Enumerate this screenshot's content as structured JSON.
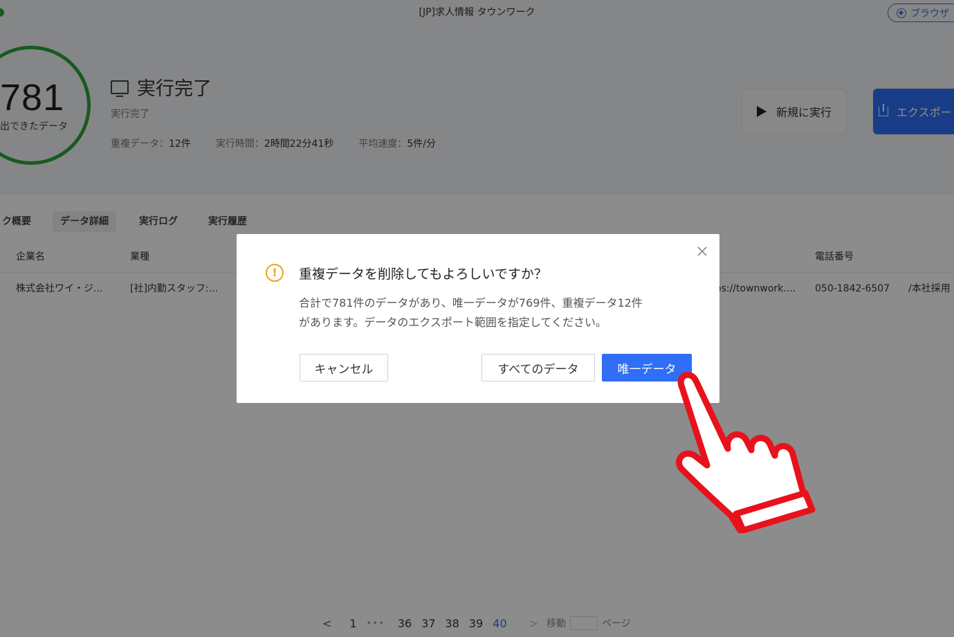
{
  "window": {
    "title": "[JP]求人情報 タウンワーク",
    "browser_button": "ブラウザ"
  },
  "summary": {
    "count": "781",
    "count_label": "出できたデータ",
    "status_title": "実行完了",
    "status_sub": "実行完了",
    "stats": [
      {
        "label": "重複データ：",
        "value": "12件"
      },
      {
        "label": "実行時間：",
        "value": "2時間22分41秒"
      },
      {
        "label": "平均速度：",
        "value": "5件/分"
      }
    ]
  },
  "actions": {
    "run_new": "新規に実行",
    "export": "エクスポート"
  },
  "tabs": [
    {
      "label": "ク概要"
    },
    {
      "label": "データ詳細"
    },
    {
      "label": "実行ログ"
    },
    {
      "label": "実行履歴"
    }
  ],
  "table": {
    "columns": [
      "企業名",
      "業種",
      "電話番号"
    ],
    "row": {
      "company": "株式会社ワイ・ジ...",
      "industry": "[社]内勤スタッフ:...",
      "url": "os://townwork....",
      "phone": "050-1842-6507",
      "extra": "/本社採用"
    }
  },
  "pagination": {
    "first": "1",
    "pages": [
      "36",
      "37",
      "38",
      "39",
      "40"
    ],
    "current": "40",
    "jump_label": "移動",
    "page_suffix": "ページ"
  },
  "dialog": {
    "title": "重複データを削除してもよろしいですか？",
    "message_line1": "合計で781件のデータがあり、唯一データが769件、重複データ12件",
    "message_line2": "があります。データのエクスポート範囲を指定してください。",
    "cancel": "キャンセル",
    "all_data": "すべてのデータ",
    "unique_data": "唯一データ"
  },
  "colors": {
    "accent": "#2f6ef5",
    "success": "#2ca53a",
    "warning": "#f0a020",
    "pointer": "#e8121c"
  }
}
